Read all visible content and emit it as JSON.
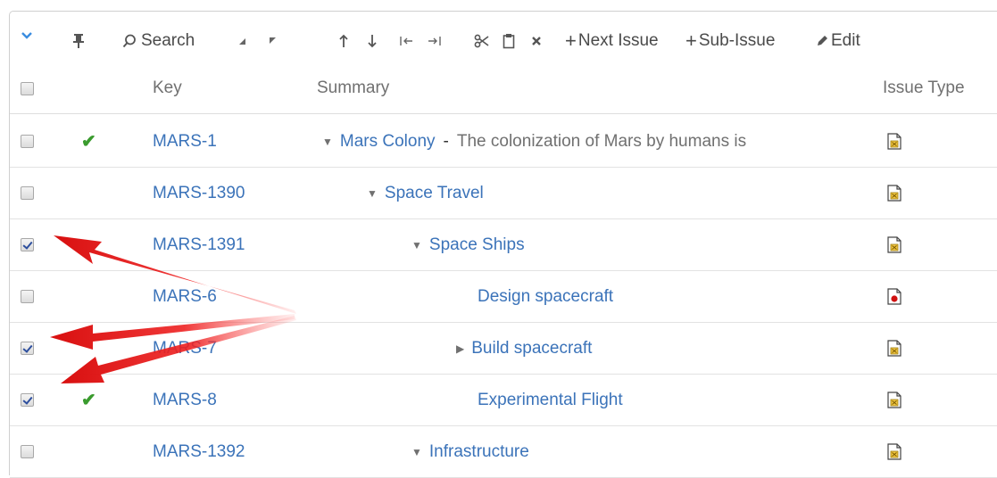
{
  "toolbar": {
    "search_label": "Search",
    "next_issue_label": "Next Issue",
    "sub_issue_label": "Sub-Issue",
    "edit_label": "Edit"
  },
  "columns": {
    "key": "Key",
    "summary": "Summary",
    "issue_type": "Issue Type"
  },
  "rows": [
    {
      "key": "MARS-1",
      "summary": "Mars Colony",
      "separator": "-",
      "description": "The colonization of Mars by humans is",
      "checked": false,
      "resolved": true,
      "expander": "down",
      "level": 0,
      "type_icon": "epic-icon"
    },
    {
      "key": "MARS-1390",
      "summary": "Space Travel",
      "checked": false,
      "resolved": false,
      "expander": "down",
      "level": 1,
      "type_icon": "epic-icon"
    },
    {
      "key": "MARS-1391",
      "summary": "Space Ships",
      "checked": true,
      "resolved": false,
      "expander": "down",
      "level": 2,
      "type_icon": "epic-icon"
    },
    {
      "key": "MARS-6",
      "summary": "Design spacecraft",
      "checked": false,
      "resolved": false,
      "expander": "none",
      "level": 3,
      "type_icon": "bug-icon"
    },
    {
      "key": "MARS-7",
      "summary": "Build spacecraft",
      "checked": true,
      "resolved": false,
      "expander": "right",
      "level": 3,
      "type_icon": "epic-icon"
    },
    {
      "key": "MARS-8",
      "summary": "Experimental Flight",
      "checked": true,
      "resolved": true,
      "expander": "none",
      "level": 3,
      "type_icon": "epic-icon"
    },
    {
      "key": "MARS-1392",
      "summary": "Infrastructure",
      "checked": false,
      "resolved": false,
      "expander": "down",
      "level": 2,
      "type_icon": "epic-icon"
    }
  ],
  "colors": {
    "link": "#3b73b9",
    "check": "#3a9b2e",
    "arrow": "#e02020",
    "text_muted": "#707070"
  }
}
